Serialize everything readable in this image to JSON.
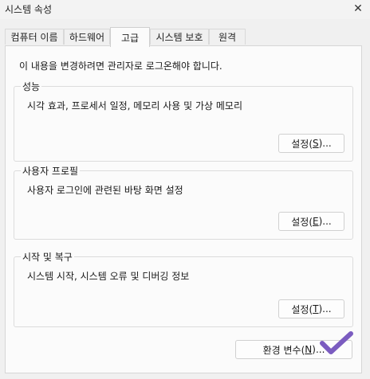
{
  "window": {
    "title": "시스템 속성",
    "close_glyph": "✕"
  },
  "tabs": [
    {
      "label": "컴퓨터 이름",
      "active": false
    },
    {
      "label": "하드웨어",
      "active": false
    },
    {
      "label": "고급",
      "active": true
    },
    {
      "label": "시스템 보호",
      "active": false
    },
    {
      "label": "원격",
      "active": false
    }
  ],
  "notice": "이 내용을 변경하려면 관리자로 로그온해야 합니다.",
  "groups": {
    "performance": {
      "title": "성능",
      "description": "시각 효과, 프로세서 일정, 메모리 사용 및 가상 메모리",
      "button": {
        "prefix": "설정(",
        "accel": "S",
        "suffix": ")..."
      }
    },
    "user_profiles": {
      "title": "사용자 프로필",
      "description": "사용자 로그인에 관련된 바탕 화면 설정",
      "button": {
        "prefix": "설정(",
        "accel": "E",
        "suffix": ")..."
      }
    },
    "startup_recovery": {
      "title": "시작 및 복구",
      "description": "시스템 시작, 시스템 오류 및 디버깅 정보",
      "button": {
        "prefix": "설정(",
        "accel": "T",
        "suffix": ")..."
      }
    }
  },
  "env_button": {
    "prefix": "환경 변수(",
    "accel": "N",
    "suffix": ")..."
  },
  "colors": {
    "checkmark": "#7b5cc0"
  },
  "icons": {
    "checkmark": "checkmark-icon"
  }
}
